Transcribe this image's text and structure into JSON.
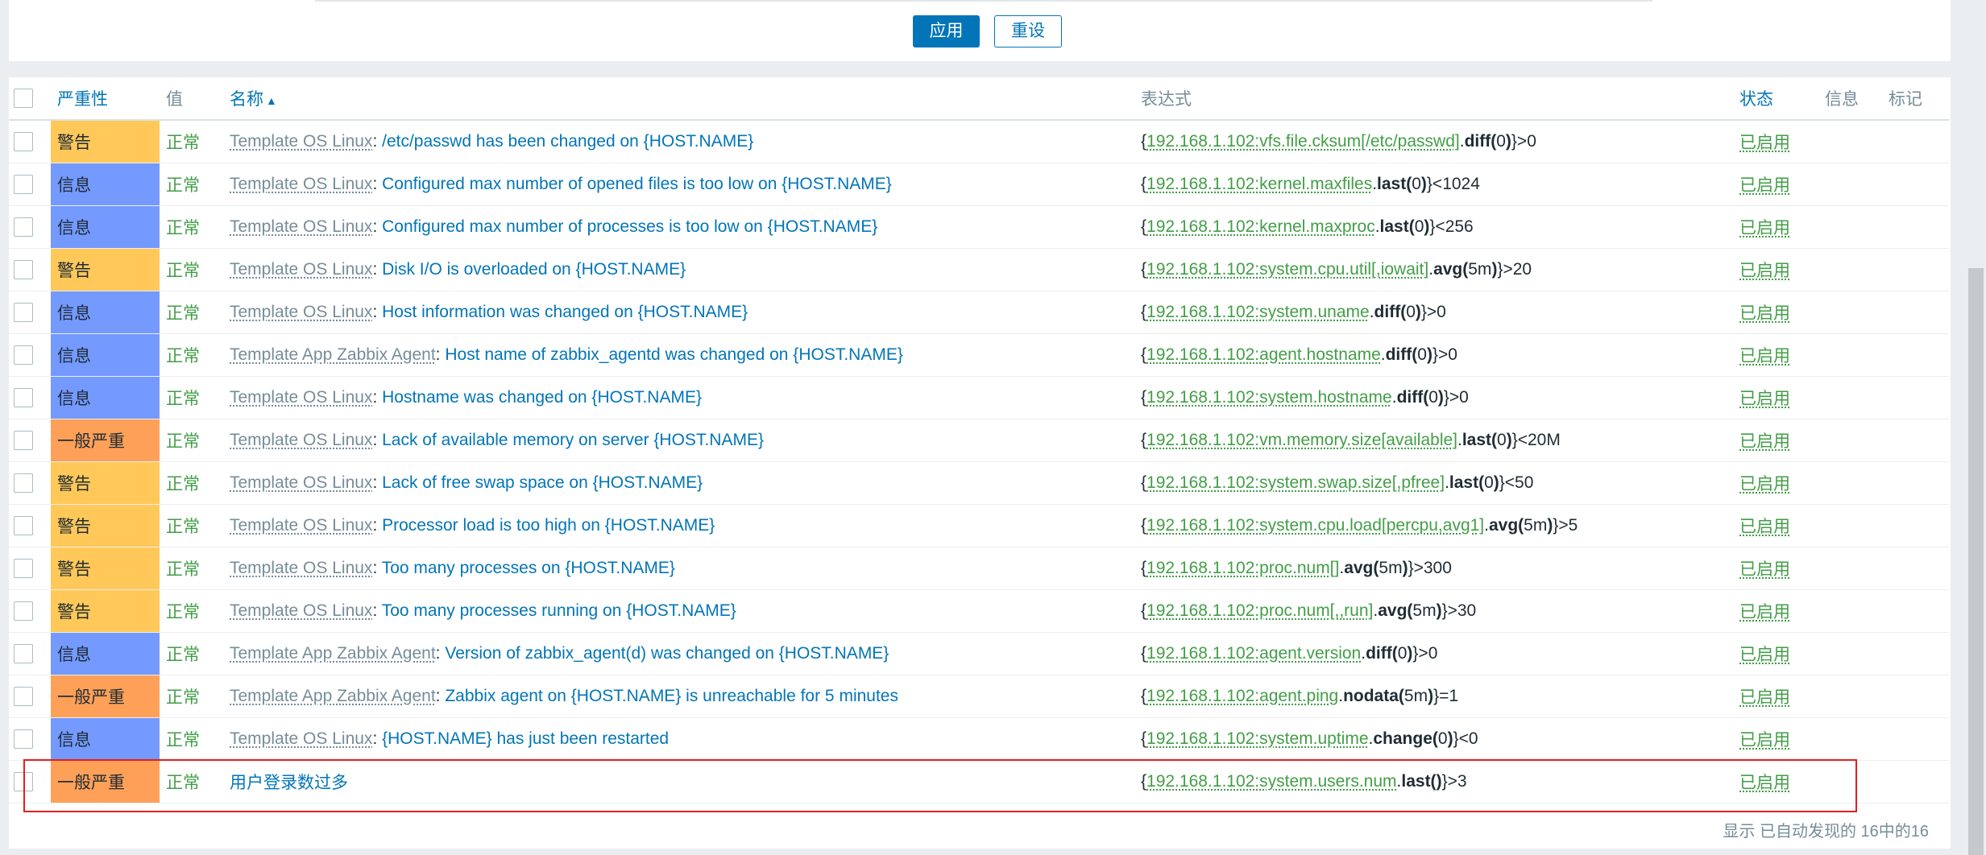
{
  "filter": {
    "apply_label": "应用",
    "reset_label": "重设"
  },
  "table": {
    "headers": {
      "severity": "严重性",
      "value": "值",
      "name": "名称",
      "expression": "表达式",
      "status": "状态",
      "info": "信息",
      "tags": "标记"
    },
    "rows": [
      {
        "severity": "警告",
        "sev_level": "warn",
        "value": "正常",
        "template": "Template OS Linux",
        "name": "/etc/passwd has been changed on {HOST.NAME}",
        "expr_open": "{",
        "expr_key": "192.168.1.102:vfs.file.cksum[/etc/passwd]",
        "expr_dot": ".",
        "expr_fn": "diff(",
        "expr_arg": "0",
        "expr_close": ")",
        "expr_tail": "}>0",
        "status": "已启用"
      },
      {
        "severity": "信息",
        "sev_level": "info",
        "value": "正常",
        "template": "Template OS Linux",
        "name": "Configured max number of opened files is too low on {HOST.NAME}",
        "expr_open": "{",
        "expr_key": "192.168.1.102:kernel.maxfiles",
        "expr_dot": ".",
        "expr_fn": "last(",
        "expr_arg": "0",
        "expr_close": ")",
        "expr_tail": "}<1024",
        "status": "已启用"
      },
      {
        "severity": "信息",
        "sev_level": "info",
        "value": "正常",
        "template": "Template OS Linux",
        "name": "Configured max number of processes is too low on {HOST.NAME}",
        "expr_open": "{",
        "expr_key": "192.168.1.102:kernel.maxproc",
        "expr_dot": ".",
        "expr_fn": "last(",
        "expr_arg": "0",
        "expr_close": ")",
        "expr_tail": "}<256",
        "status": "已启用"
      },
      {
        "severity": "警告",
        "sev_level": "warn",
        "value": "正常",
        "template": "Template OS Linux",
        "name": "Disk I/O is overloaded on {HOST.NAME}",
        "expr_open": "{",
        "expr_key": "192.168.1.102:system.cpu.util[,iowait]",
        "expr_dot": ".",
        "expr_fn": "avg(",
        "expr_arg": "5m",
        "expr_close": ")",
        "expr_tail": "}>20",
        "status": "已启用"
      },
      {
        "severity": "信息",
        "sev_level": "info",
        "value": "正常",
        "template": "Template OS Linux",
        "name": "Host information was changed on {HOST.NAME}",
        "expr_open": "{",
        "expr_key": "192.168.1.102:system.uname",
        "expr_dot": ".",
        "expr_fn": "diff(",
        "expr_arg": "0",
        "expr_close": ")",
        "expr_tail": "}>0",
        "status": "已启用"
      },
      {
        "severity": "信息",
        "sev_level": "info",
        "value": "正常",
        "template": "Template App Zabbix Agent",
        "name": "Host name of zabbix_agentd was changed on {HOST.NAME}",
        "expr_open": "{",
        "expr_key": "192.168.1.102:agent.hostname",
        "expr_dot": ".",
        "expr_fn": "diff(",
        "expr_arg": "0",
        "expr_close": ")",
        "expr_tail": "}>0",
        "status": "已启用"
      },
      {
        "severity": "信息",
        "sev_level": "info",
        "value": "正常",
        "template": "Template OS Linux",
        "name": "Hostname was changed on {HOST.NAME}",
        "expr_open": "{",
        "expr_key": "192.168.1.102:system.hostname",
        "expr_dot": ".",
        "expr_fn": "diff(",
        "expr_arg": "0",
        "expr_close": ")",
        "expr_tail": "}>0",
        "status": "已启用"
      },
      {
        "severity": "一般严重",
        "sev_level": "avg",
        "value": "正常",
        "template": "Template OS Linux",
        "name": "Lack of available memory on server {HOST.NAME}",
        "expr_open": "{",
        "expr_key": "192.168.1.102:vm.memory.size[available]",
        "expr_dot": ".",
        "expr_fn": "last(",
        "expr_arg": "0",
        "expr_close": ")",
        "expr_tail": "}<20M",
        "status": "已启用"
      },
      {
        "severity": "警告",
        "sev_level": "warn",
        "value": "正常",
        "template": "Template OS Linux",
        "name": "Lack of free swap space on {HOST.NAME}",
        "expr_open": "{",
        "expr_key": "192.168.1.102:system.swap.size[,pfree]",
        "expr_dot": ".",
        "expr_fn": "last(",
        "expr_arg": "0",
        "expr_close": ")",
        "expr_tail": "}<50",
        "status": "已启用"
      },
      {
        "severity": "警告",
        "sev_level": "warn",
        "value": "正常",
        "template": "Template OS Linux",
        "name": "Processor load is too high on {HOST.NAME}",
        "expr_open": "{",
        "expr_key": "192.168.1.102:system.cpu.load[percpu,avg1]",
        "expr_dot": ".",
        "expr_fn": "avg(",
        "expr_arg": "5m",
        "expr_close": ")",
        "expr_tail": "}>5",
        "status": "已启用"
      },
      {
        "severity": "警告",
        "sev_level": "warn",
        "value": "正常",
        "template": "Template OS Linux",
        "name": "Too many processes on {HOST.NAME}",
        "expr_open": "{",
        "expr_key": "192.168.1.102:proc.num[]",
        "expr_dot": ".",
        "expr_fn": "avg(",
        "expr_arg": "5m",
        "expr_close": ")",
        "expr_tail": "}>300",
        "status": "已启用"
      },
      {
        "severity": "警告",
        "sev_level": "warn",
        "value": "正常",
        "template": "Template OS Linux",
        "name": "Too many processes running on {HOST.NAME}",
        "expr_open": "{",
        "expr_key": "192.168.1.102:proc.num[,,run]",
        "expr_dot": ".",
        "expr_fn": "avg(",
        "expr_arg": "5m",
        "expr_close": ")",
        "expr_tail": "}>30",
        "status": "已启用"
      },
      {
        "severity": "信息",
        "sev_level": "info",
        "value": "正常",
        "template": "Template App Zabbix Agent",
        "name": "Version of zabbix_agent(d) was changed on {HOST.NAME}",
        "expr_open": "{",
        "expr_key": "192.168.1.102:agent.version",
        "expr_dot": ".",
        "expr_fn": "diff(",
        "expr_arg": "0",
        "expr_close": ")",
        "expr_tail": "}>0",
        "status": "已启用"
      },
      {
        "severity": "一般严重",
        "sev_level": "avg",
        "value": "正常",
        "template": "Template App Zabbix Agent",
        "name": "Zabbix agent on {HOST.NAME} is unreachable for 5 minutes",
        "expr_open": "{",
        "expr_key": "192.168.1.102:agent.ping",
        "expr_dot": ".",
        "expr_fn": "nodata(",
        "expr_arg": "5m",
        "expr_close": ")",
        "expr_tail": "}=1",
        "status": "已启用"
      },
      {
        "severity": "信息",
        "sev_level": "info",
        "value": "正常",
        "template": "Template OS Linux",
        "name": "{HOST.NAME} has just been restarted",
        "expr_open": "{",
        "expr_key": "192.168.1.102:system.uptime",
        "expr_dot": ".",
        "expr_fn": "change(",
        "expr_arg": "0",
        "expr_close": ")",
        "expr_tail": "}<0",
        "status": "已启用"
      },
      {
        "severity": "一般严重",
        "sev_level": "avg",
        "value": "正常",
        "template": "",
        "name": "用户登录数过多",
        "expr_open": "{",
        "expr_key": "192.168.1.102:system.users.num",
        "expr_dot": ".",
        "expr_fn": "last(",
        "expr_arg": "",
        "expr_close": ")",
        "expr_tail": "}>3",
        "status": "已启用"
      }
    ]
  },
  "footer": {
    "summary": "显示 已自动发现的 16中的16"
  },
  "colors": {
    "warning": "#ffc859",
    "information": "#7499ff",
    "average": "#ffa059",
    "link": "#0275b8",
    "ok": "#429e47",
    "highlight_box": "#e02020"
  }
}
